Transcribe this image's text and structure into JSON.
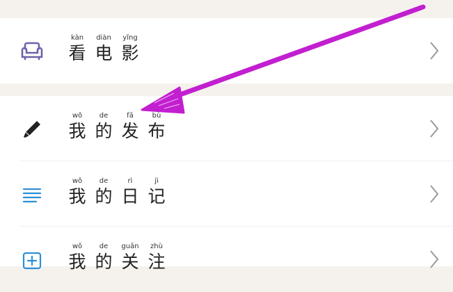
{
  "top_section": {
    "items": [
      {
        "icon": "sofa-icon",
        "chars": [
          {
            "pinyin": "kàn",
            "hanzi": "看"
          },
          {
            "pinyin": "diàn",
            "hanzi": "电"
          },
          {
            "pinyin": "yǐng",
            "hanzi": "影"
          }
        ]
      }
    ]
  },
  "main_section": {
    "items": [
      {
        "icon": "pencil-icon",
        "chars": [
          {
            "pinyin": "wǒ",
            "hanzi": "我"
          },
          {
            "pinyin": "de",
            "hanzi": "的"
          },
          {
            "pinyin": "fā",
            "hanzi": "发"
          },
          {
            "pinyin": "bù",
            "hanzi": "布"
          }
        ]
      },
      {
        "icon": "list-lines-icon",
        "chars": [
          {
            "pinyin": "wǒ",
            "hanzi": "我"
          },
          {
            "pinyin": "de",
            "hanzi": "的"
          },
          {
            "pinyin": "rì",
            "hanzi": "日"
          },
          {
            "pinyin": "jì",
            "hanzi": "记"
          }
        ]
      },
      {
        "icon": "plus-square-icon",
        "chars": [
          {
            "pinyin": "wǒ",
            "hanzi": "我"
          },
          {
            "pinyin": "de",
            "hanzi": "的"
          },
          {
            "pinyin": "guān",
            "hanzi": "关"
          },
          {
            "pinyin": "zhù",
            "hanzi": "注"
          }
        ]
      }
    ]
  },
  "colors": {
    "background": "#f5f2ee",
    "sofa_icon": "#6b63a8",
    "list_icon": "#2c8fd8",
    "plus_icon": "#2c8fd8",
    "annotation_arrow": "#c21fd0"
  }
}
